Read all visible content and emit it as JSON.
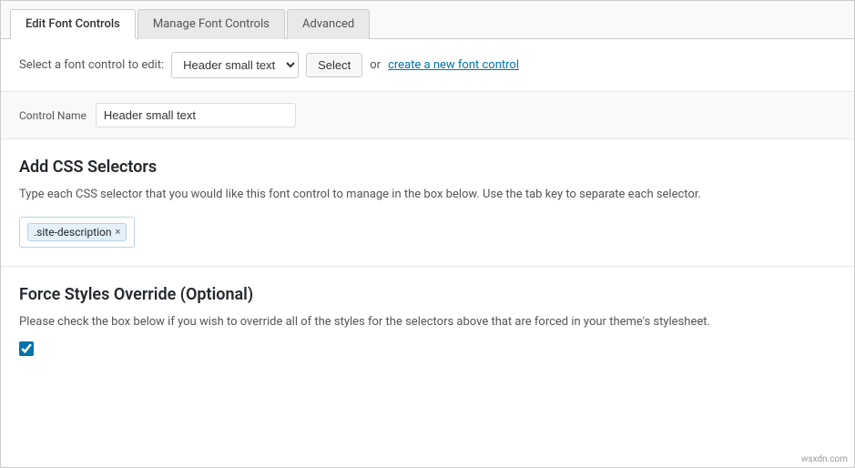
{
  "tabs": [
    {
      "id": "edit",
      "label": "Edit Font Controls",
      "active": true
    },
    {
      "id": "manage",
      "label": "Manage Font Controls",
      "active": false
    },
    {
      "id": "advanced",
      "label": "Advanced",
      "active": false
    }
  ],
  "select_bar": {
    "label": "Select a font control to edit:",
    "selected_option": "Header small text",
    "select_button_label": "Select",
    "or_text": "or",
    "create_link_text": "create a new font control"
  },
  "control_name": {
    "label": "Control Name",
    "value": "Header small text"
  },
  "css_section": {
    "title": "Add CSS Selectors",
    "description": "Type each CSS selector that you would like this font control to manage in the box below. Use the tab key to separate each selector.",
    "selectors": [
      {
        "label": ".site-description"
      }
    ]
  },
  "force_section": {
    "title": "Force Styles Override (Optional)",
    "description": "Please check the box below if you wish to override all of the styles for the selectors above that are forced in your theme's stylesheet.",
    "checkbox_checked": true
  },
  "watermark": "wsxdn.com"
}
